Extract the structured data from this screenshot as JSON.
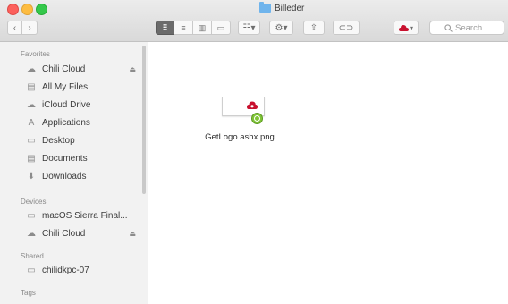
{
  "window": {
    "title": "Billeder",
    "title_icon": "folder-icon"
  },
  "toolbar": {
    "back_icon": "‹",
    "forward_icon": "›",
    "view_modes": [
      {
        "name": "icon-view",
        "glyph": "⠿",
        "active": true
      },
      {
        "name": "list-view",
        "glyph": "≡",
        "active": false
      },
      {
        "name": "column-view",
        "glyph": "▥",
        "active": false
      },
      {
        "name": "gallery-view",
        "glyph": "▭",
        "active": false
      }
    ],
    "arrange_glyph": "☷▾",
    "action_glyph": "⚙▾",
    "share_glyph": "⇪",
    "tags_glyph": "⊂⊃",
    "chili_glyph": "▾",
    "search_placeholder": "Search",
    "accent_color": "#c8102e"
  },
  "sidebar": {
    "favorites_header": "Favorites",
    "favorites": [
      {
        "label": "Chili Cloud",
        "icon": "cloud-icon",
        "glyph": "☁",
        "eject": "⏏"
      },
      {
        "label": "All My Files",
        "icon": "all-files-icon",
        "glyph": "▤"
      },
      {
        "label": "iCloud Drive",
        "icon": "icloud-icon",
        "glyph": "☁"
      },
      {
        "label": "Applications",
        "icon": "applications-icon",
        "glyph": "A"
      },
      {
        "label": "Desktop",
        "icon": "desktop-icon",
        "glyph": "▭"
      },
      {
        "label": "Documents",
        "icon": "documents-icon",
        "glyph": "▤"
      },
      {
        "label": "Downloads",
        "icon": "downloads-icon",
        "glyph": "⬇"
      }
    ],
    "devices_header": "Devices",
    "devices": [
      {
        "label": "macOS Sierra Final...",
        "icon": "disk-icon",
        "glyph": "▭"
      },
      {
        "label": "Chili Cloud",
        "icon": "cloud-icon",
        "glyph": "☁",
        "eject": "⏏"
      }
    ],
    "shared_header": "Shared",
    "shared": [
      {
        "label": "chilidkpc-07",
        "icon": "computer-icon",
        "glyph": "▭"
      }
    ],
    "tags_header": "Tags"
  },
  "content": {
    "files": [
      {
        "name": "GetLogo.ashx.png",
        "badge": "sync-badge-icon"
      }
    ]
  }
}
